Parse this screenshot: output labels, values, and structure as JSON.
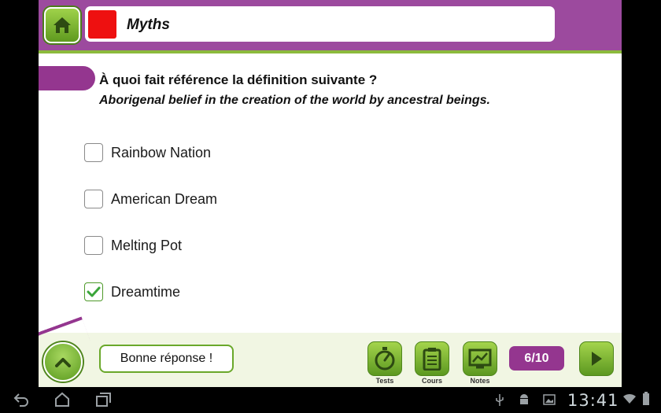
{
  "header": {
    "title": "Myths",
    "title_color": "#ee1010",
    "accent_color": "#9c4a9e"
  },
  "question": {
    "prompt": "À quoi fait référence la définition suivante ?",
    "definition": "Aborigenal belief in the creation of the world by ancestral beings."
  },
  "options": [
    {
      "label": "Rainbow Nation",
      "checked": false
    },
    {
      "label": "American Dream",
      "checked": false
    },
    {
      "label": "Melting Pot",
      "checked": false
    },
    {
      "label": "Dreamtime",
      "checked": true
    }
  ],
  "footer": {
    "feedback": "Bonne réponse !",
    "tools": [
      {
        "label": "Tests",
        "icon": "stopwatch-icon"
      },
      {
        "label": "Cours",
        "icon": "clipboard-icon"
      },
      {
        "label": "Notes",
        "icon": "chart-board-icon"
      }
    ],
    "progress": "6/10"
  },
  "system_bar": {
    "clock": "13:41"
  }
}
